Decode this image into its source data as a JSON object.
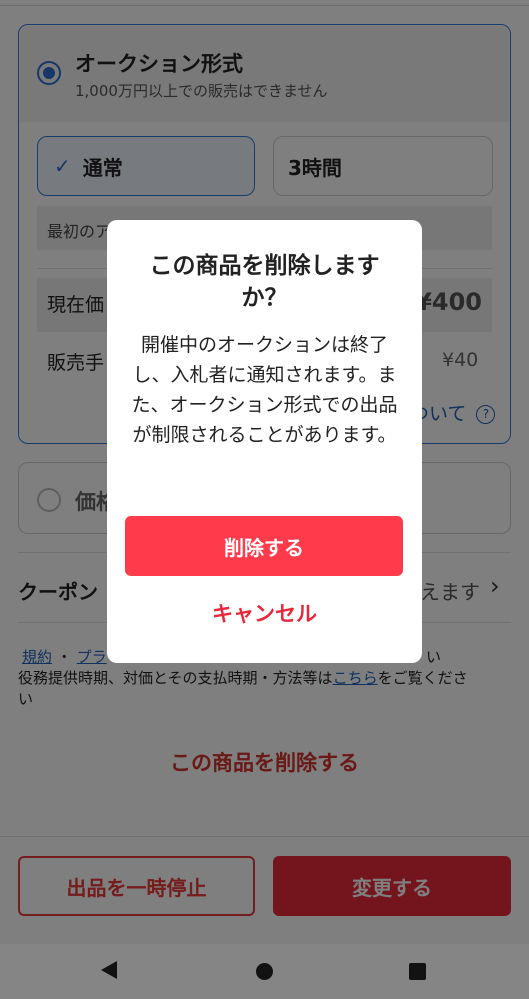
{
  "auction": {
    "title": "オークション形式",
    "subtitle": "1,000万円以上での販売はできません",
    "options": [
      "通常",
      "3時間"
    ],
    "first_label": "最初のア",
    "current_label": "現在価",
    "current_value": "¥400",
    "fee_label": "販売手",
    "fee_value": "¥40",
    "about_link": "ついて"
  },
  "fixed": {
    "label": "価格"
  },
  "coupon": {
    "label": "クーポン",
    "right": "えます"
  },
  "terms": {
    "link1": "規約",
    "sep": "・",
    "link2": "プラ",
    "tail": "い",
    "line2a": "役務提供時期、対価とその支払時期・方法等は",
    "line2link": "こちら",
    "line2b": "をご覧くださ",
    "line3": "い"
  },
  "delete_link": "この商品を削除する",
  "footer": {
    "pause": "出品を一時停止",
    "change": "変更する"
  },
  "dialog": {
    "title": "この商品を削除しますか？",
    "body": "開催中のオークションは終了し、入札者に通知されます。また、オークション形式での出品が制限されることがあります。",
    "confirm": "削除する",
    "cancel": "キャンセル"
  },
  "icons": [
    "check-icon",
    "help-icon",
    "chevron-right-icon",
    "back-icon",
    "home-icon",
    "recents-icon"
  ],
  "colors": {
    "accent": "#e8283a",
    "blue": "#2f7ad6",
    "link": "#1e63b8"
  }
}
